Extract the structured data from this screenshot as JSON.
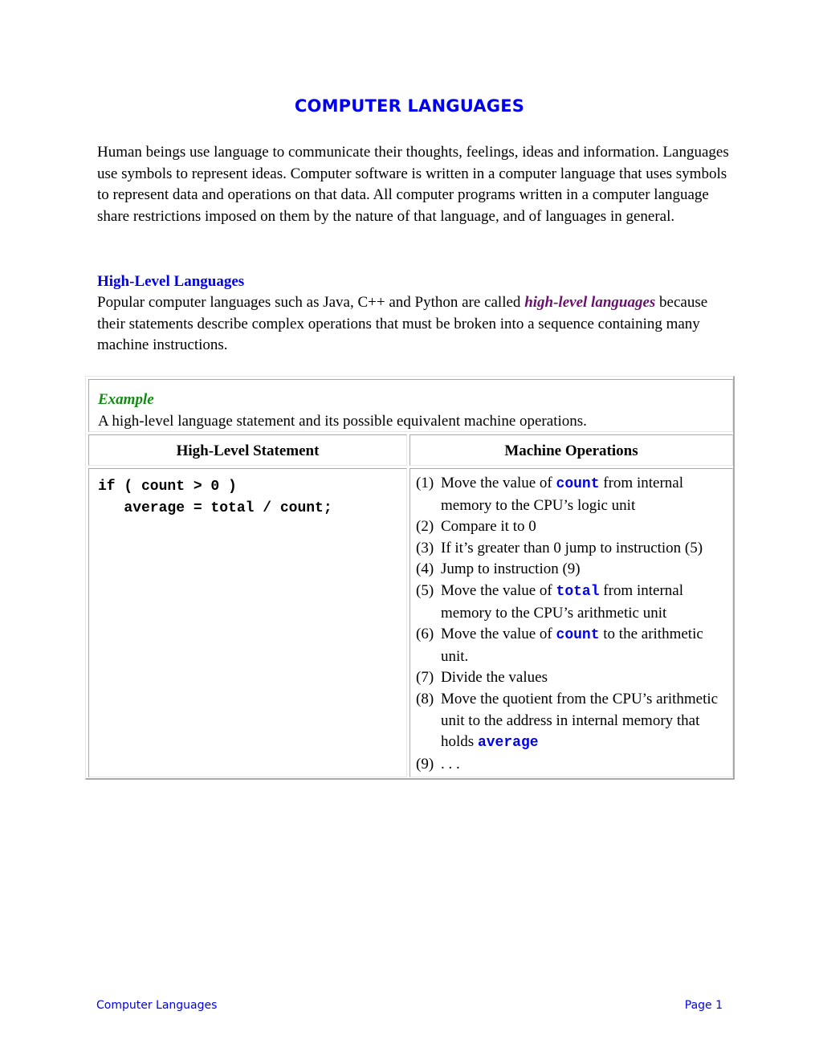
{
  "document": {
    "title": "COMPUTER LANGUAGES",
    "intro": "Human beings use language to communicate their thoughts, feelings, ideas and information. Languages use symbols to represent ideas. Computer software is written in a computer language that uses symbols to represent data and operations on that data. All computer programs written in a computer language share restrictions imposed on them by the nature of that language, and of languages in general.",
    "section": {
      "heading": "High-Level Languages",
      "text_before": "Popular computer languages such as Java, C++ and Python are called ",
      "term": "high-level languages",
      "text_after": " because their statements describe complex operations that must be broken into a sequence containing many machine instructions."
    },
    "example": {
      "title": "Example",
      "caption": "A high-level language statement and its possible equivalent machine operations.",
      "headers": [
        "High-Level Statement",
        "Machine Operations"
      ],
      "code_lines": [
        "if ( count > 0 )",
        "   average = total / count;"
      ],
      "operations": [
        {
          "num": "(1)",
          "before": "Move the value of ",
          "code": "count",
          "after": " from internal memory to the CPU’s logic unit"
        },
        {
          "num": "(2)",
          "before": "Compare it to 0",
          "code": "",
          "after": ""
        },
        {
          "num": "(3)",
          "before": "If it’s greater than 0 jump to instruction (5)",
          "code": "",
          "after": ""
        },
        {
          "num": "(4)",
          "before": "Jump to instruction (9)",
          "code": "",
          "after": ""
        },
        {
          "num": "(5)",
          "before": "Move the value of ",
          "code": "total",
          "after": " from internal memory to the CPU’s arithmetic unit"
        },
        {
          "num": "(6)",
          "before": "Move the value of ",
          "code": "count",
          "after": " to the arithmetic unit."
        },
        {
          "num": "(7)",
          "before": "Divide the values",
          "code": "",
          "after": ""
        },
        {
          "num": "(8)",
          "before": "Move the quotient from the CPU’s arithmetic unit to the address in internal memory that holds ",
          "code": "average",
          "after": ""
        },
        {
          "num": "(9)",
          "before": ". . .",
          "code": "",
          "after": ""
        }
      ]
    },
    "footer": {
      "left": "Computer Languages",
      "right": "Page 1"
    }
  },
  "colors": {
    "heading_blue": "#0000ee",
    "term_purple": "#6a0f6e",
    "example_green": "#138a13"
  }
}
